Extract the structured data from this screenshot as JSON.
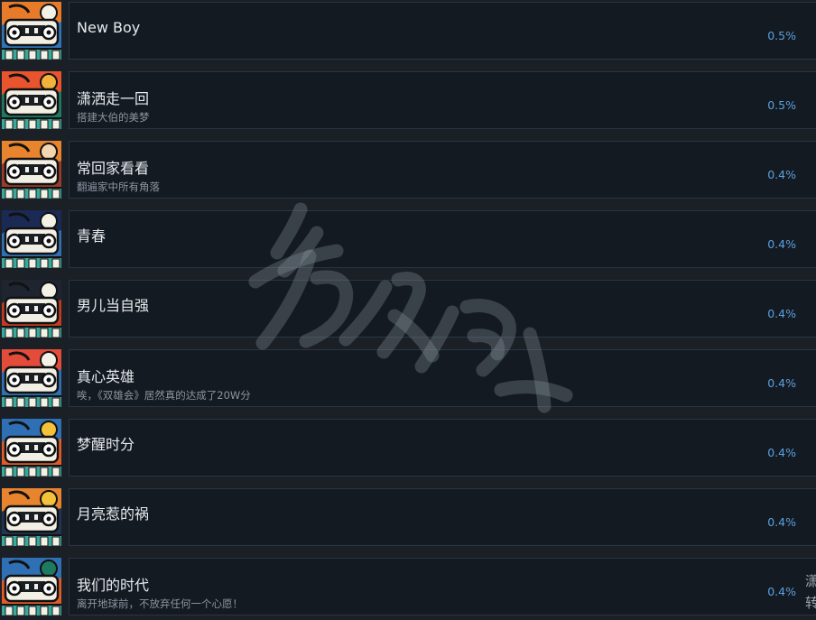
{
  "achievements": [
    {
      "title": "New Boy",
      "desc": "",
      "pct": "0.5%",
      "colors": [
        "#2f74b8",
        "#e87b2a",
        "#f4f1e6"
      ]
    },
    {
      "title": "潇洒走一回",
      "desc": "搭建大伯的美梦",
      "pct": "0.5%",
      "colors": [
        "#1d7a60",
        "#e8542e",
        "#f2b33a"
      ]
    },
    {
      "title": "常回家看看",
      "desc": "翻遍家中所有角落",
      "pct": "0.4%",
      "colors": [
        "#9c3b2a",
        "#e8842e",
        "#f3d6b0"
      ]
    },
    {
      "title": "青春",
      "desc": "",
      "pct": "0.4%",
      "colors": [
        "#2f6fb3",
        "#1b2a55",
        "#f4f1e6"
      ]
    },
    {
      "title": "男儿当自强",
      "desc": "",
      "pct": "0.4%",
      "colors": [
        "#c23a22",
        "#1e2530",
        "#f4f1e6"
      ]
    },
    {
      "title": "真心英雄",
      "desc": "唉，《双雄会》居然真的达成了20W分",
      "pct": "0.4%",
      "colors": [
        "#2f6fb3",
        "#e34b3a",
        "#f4f1e6"
      ]
    },
    {
      "title": "梦醒时分",
      "desc": "",
      "pct": "0.4%",
      "colors": [
        "#e05a2a",
        "#2f6fb3",
        "#f3c13a"
      ]
    },
    {
      "title": "月亮惹的祸",
      "desc": "",
      "pct": "0.4%",
      "colors": [
        "#1e3555",
        "#e8842e",
        "#f3c13a"
      ]
    },
    {
      "title": "我们的时代",
      "desc": "离开地球前，不放弃任何一个心愿！",
      "pct": "0.4%",
      "colors": [
        "#e05a2a",
        "#2f6fb3",
        "#1d7a60"
      ]
    }
  ],
  "side_hint": "潇转",
  "watermark_text": "游侠网"
}
